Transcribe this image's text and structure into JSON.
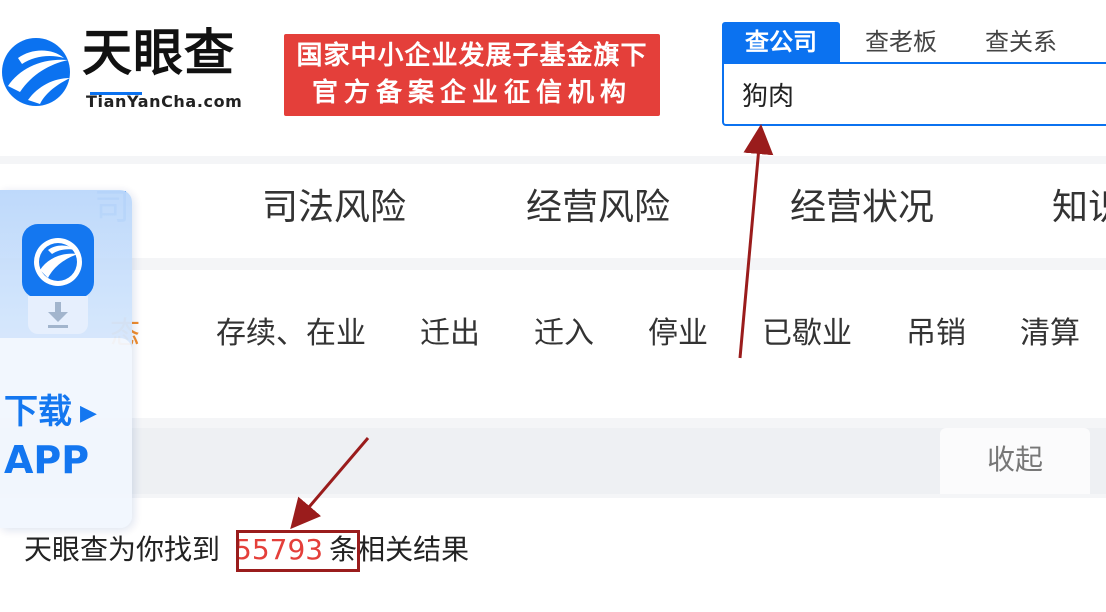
{
  "header": {
    "logo_text": "天眼查",
    "logo_domain": "TianYanCha.com",
    "banner_line1": "国家中小企业发展子基金旗下",
    "banner_line2": "官方备案企业征信机构"
  },
  "search": {
    "tabs": [
      {
        "label": "查公司",
        "active": true
      },
      {
        "label": "查老板",
        "active": false
      },
      {
        "label": "查关系",
        "active": false
      }
    ],
    "value": "狗肉"
  },
  "categories": {
    "items": [
      "司",
      "司法风险",
      "经营风险",
      "经营状况",
      "知识"
    ],
    "active_index": 0
  },
  "status_filter": {
    "label": "态",
    "options": [
      "存续、在业",
      "迁出",
      "迁入",
      "停业",
      "已歇业",
      "吊销",
      "清算"
    ]
  },
  "collapse_label": "收起",
  "result": {
    "prefix": "天眼查为你找到",
    "count": "55793",
    "suffix": "条相关结果"
  },
  "app_widget": {
    "line1": "下载",
    "line2": "APP"
  },
  "colors": {
    "brand_blue": "#0b72f0",
    "banner_red": "#e43f3a",
    "annotation_red": "#9a1c1c",
    "status_label_orange": "#f38c2a"
  },
  "icons": [
    "tianyancha-logo-icon",
    "app-logo-icon",
    "download-icon",
    "play-arrow-icon"
  ]
}
